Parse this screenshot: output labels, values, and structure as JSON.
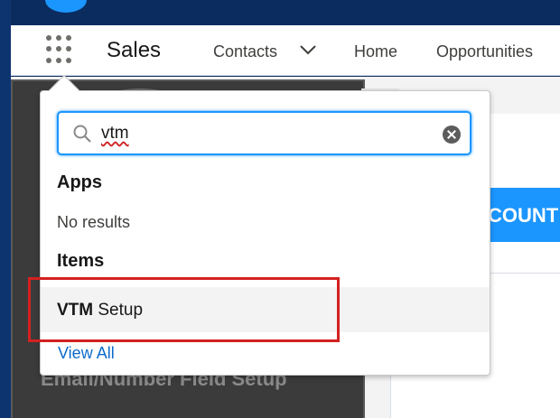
{
  "header": {
    "app_name": "Sales",
    "nav": [
      {
        "label": "Contacts"
      },
      {
        "label": "Home"
      },
      {
        "label": "Opportunities"
      }
    ]
  },
  "search": {
    "value": "vtm"
  },
  "results": {
    "apps_heading": "Apps",
    "apps_empty": "No results",
    "items_heading": "Items",
    "items": [
      {
        "match": "VTM",
        "rest": " Setup"
      }
    ],
    "view_all": "View All"
  },
  "background": {
    "panel_heading": "Email/Number Field Setup",
    "banner_text": "COUNT"
  },
  "colors": {
    "accent": "#1b96ff",
    "highlight": "#d42020",
    "link": "#0b6bcb"
  }
}
